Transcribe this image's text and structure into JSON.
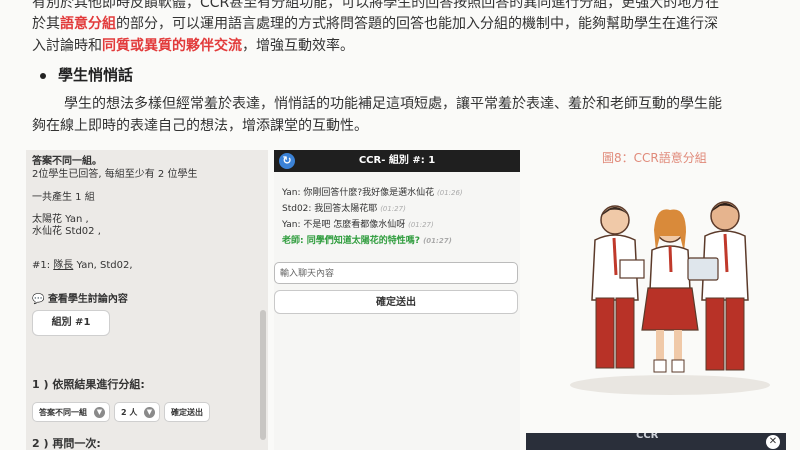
{
  "article": {
    "line1": "有別於其他即時反饋軟體，CCR甚至有分組功能，可以將學生的回答按照回答的異同進行分組，更強大的地方在",
    "line2_a": "於其",
    "line2_hl": "語意分組",
    "line2_b": "的部分，可以運用語言處理的方式將問答題的回答也能加入分組的機制中，能夠幫助學生在進行深",
    "line3_a": "入討論時和",
    "line3_hl": "同質或異質的夥伴交流",
    "line3_b": "，增強互動效率。",
    "bullet_heading": "學生悄悄話",
    "p2_line1": "學生的想法多樣但經常羞於表達，悄悄話的功能補足這項短處，讓平常羞於表達、羞於和老師互動的學生能",
    "p2_line2": "夠在線上即時的表達自己的想法，增添課堂的互動性。"
  },
  "left_panel": {
    "title": "答案不同一組。",
    "subtitle": "2位學生已回答, 每組至少有 2 位學生",
    "groups_count": "一共產生 1 組",
    "answer_1": "太陽花 Yan ,",
    "answer_2": "水仙花 Std02 ,",
    "group_members_prefix": "#1: ",
    "group_leader_label": "隊長",
    "group_members_rest": " Yan, Std02,",
    "discussion_link": "查看學生討論內容",
    "group_button": "組別 #1",
    "step1_label": "1 ) 依照結果進行分組:",
    "select_mode": "答案不同一組",
    "select_size": "2 人",
    "confirm_button": "確定送出",
    "step2_label": "2 ) 再問一次:"
  },
  "chat": {
    "header_title": "CCR- 組別 #: 1",
    "messages": [
      {
        "sender": "Yan",
        "text": "Yan: 你剛回答什麼?我好像是選水仙花",
        "time": "(01:26)"
      },
      {
        "sender": "Std02",
        "text": "Std02: 我回答太陽花耶",
        "time": "(01:27)"
      },
      {
        "sender": "Yan",
        "text": "Yan: 不是吧 怎麼看都像水仙呀",
        "time": "(01:27)"
      },
      {
        "sender": "老師",
        "text": "老師: 同學們知道太陽花的特性嗎?",
        "time": "(01:27)"
      }
    ],
    "input_placeholder": "輸入聊天內容",
    "send_button": "確定送出"
  },
  "figure": {
    "caption": "圖8：CCR語意分組"
  },
  "bottom_shot": {
    "header": "CCR"
  },
  "colors": {
    "highlight": "#e23b3b",
    "teacher_message": "#2e9c3c",
    "header_bar": "#1f1f1f",
    "back_button": "#3b82d6",
    "caption": "#e08a7a"
  }
}
